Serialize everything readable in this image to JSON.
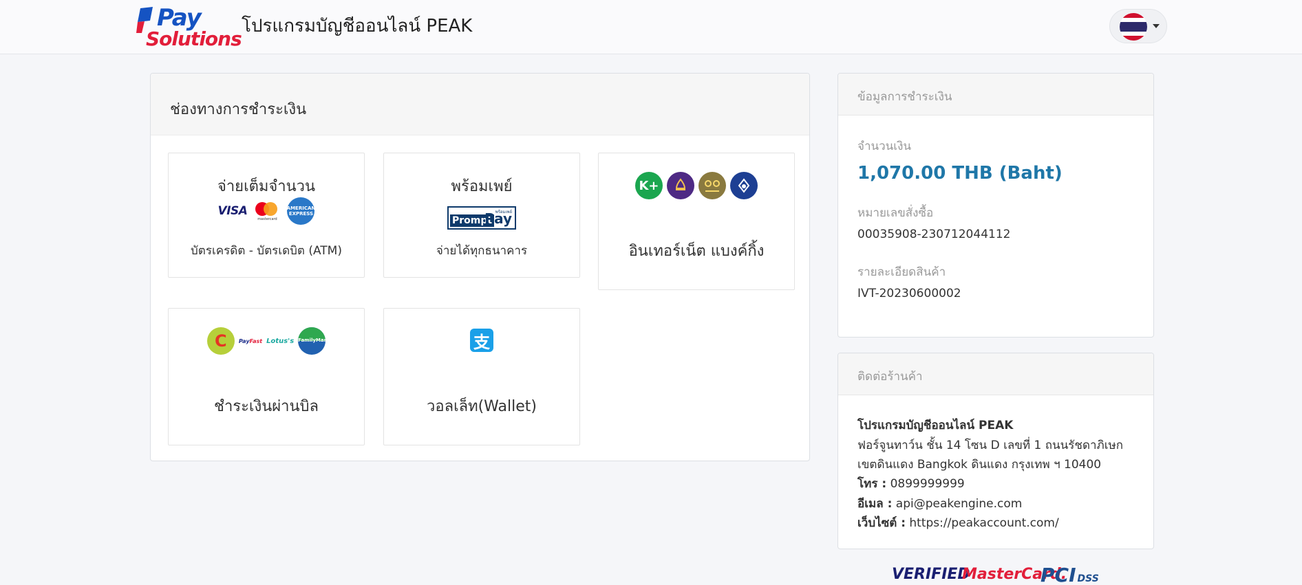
{
  "header": {
    "logo_top": "Pay",
    "logo_bottom": "Solutions",
    "title": "โปรแกรมบัญชีออนไลน์ PEAK",
    "language_flag": "thailand-flag-icon"
  },
  "payment_channels": {
    "title": "ช่องทางการชำระเงิน",
    "options": [
      {
        "title": "จ่ายเต็มจำนวน",
        "subtitle": "บัตรเครดิต - บัตรเดบิต (ATM)",
        "icons": {
          "visa": "VISA",
          "mastercard": "mastercard",
          "amex": "AMERICAN EXPRESS"
        }
      },
      {
        "title": "พร้อมเพย์",
        "subtitle": "จ่ายได้ทุกธนาคาร",
        "icons": {
          "promptpay_header": "พร้อมเพย์",
          "promptpay_a": "Prompt",
          "promptpay_b": "Pay"
        }
      },
      {
        "title": "อินเทอร์เน็ต แบงค์กิ้ง",
        "icons": {
          "kplus": "K+"
        }
      },
      {
        "title": "ชำระเงินผ่านบิล",
        "icons": {
          "bigc": "C",
          "payfast_a": "Pay",
          "payfast_b": "Fast",
          "lotus": "Lotus's",
          "familymart": "FamilyMart"
        }
      },
      {
        "title": "วอลเล็ท(Wallet)",
        "icons": {
          "alipay": "支"
        }
      }
    ]
  },
  "payment_info": {
    "title": "ข้อมูลการชำระเงิน",
    "amount_label": "จำนวนเงิน",
    "amount": "1,070.00 THB (Baht)",
    "order_label": "หมายเลขสั่งซื้อ",
    "order_number": "00035908-230712044112",
    "detail_label": "รายละเอียดสินค้า",
    "detail": "IVT-20230600002"
  },
  "merchant_contact": {
    "title": "ติดต่อร้านค้า",
    "name": "โปรแกรมบัญชีออนไลน์ PEAK",
    "address_line1": "ฟอร์จูนทาว์น ชั้น 14 โซน D เลขที่ 1 ถนนรัชดาภิเษก",
    "address_line2": "เขตดินแดง Bangkok ดินแดง กรุงเทพ ฯ 10400",
    "phone_label": "โทร :",
    "phone": "0899999999",
    "email_label": "อีเมล :",
    "email": "api@peakengine.com",
    "website_label": "เว็บไซต์ :",
    "website": "https://peakaccount.com/"
  },
  "trust_badges": {
    "verified": "VERIFIED",
    "mastercard": "MasterCard.",
    "pci": "PCI",
    "dss": "DSS"
  },
  "colors": {
    "amount": "#1f77a8",
    "brand_blue": "#1553c2",
    "brand_red": "#e21e3a"
  }
}
